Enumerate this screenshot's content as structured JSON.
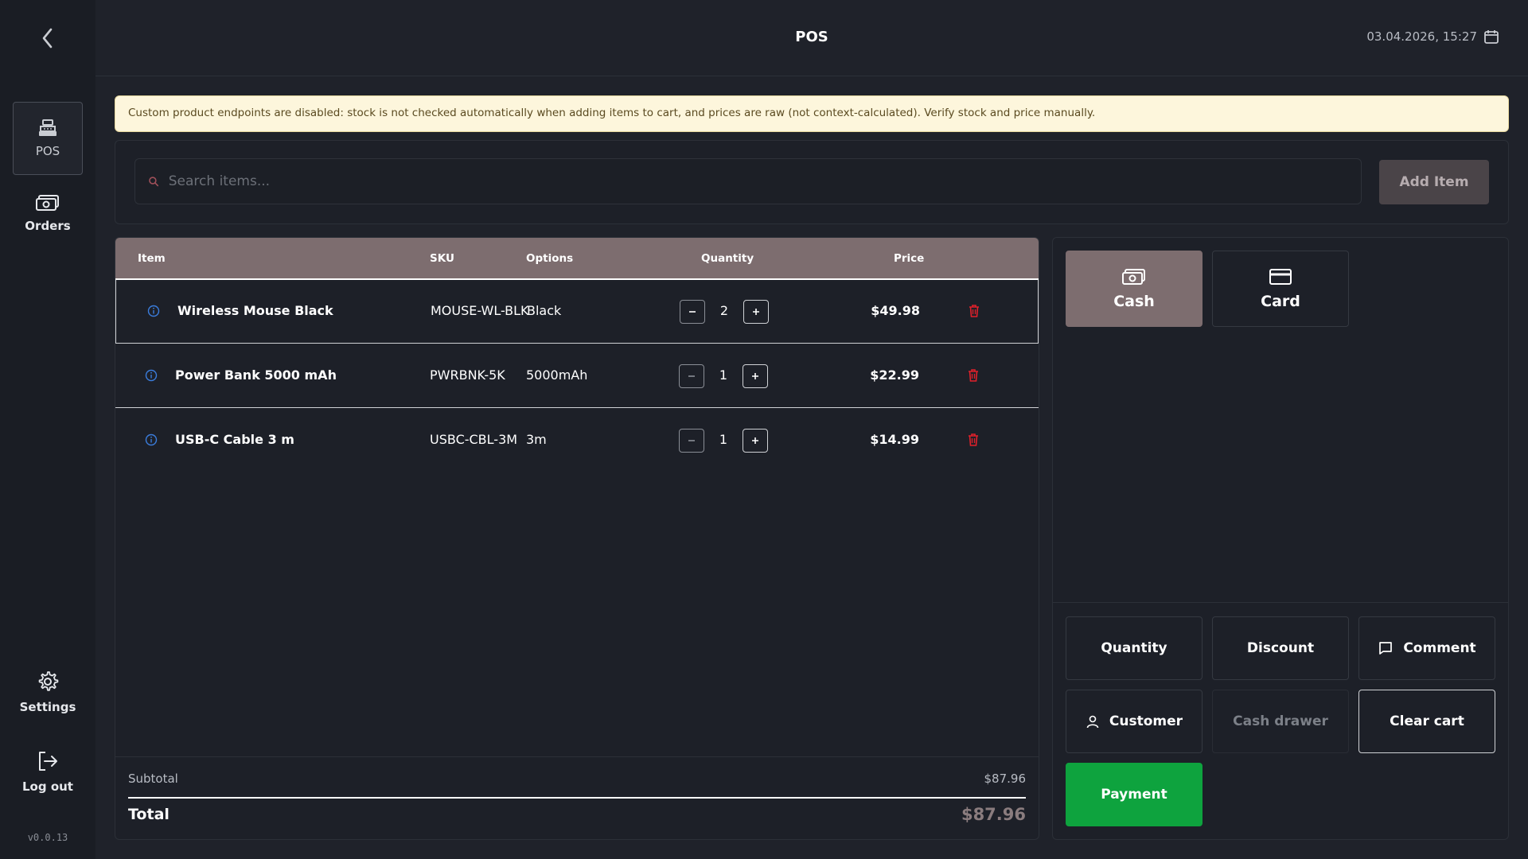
{
  "app": {
    "title": "POS",
    "datetime": "03.04.2026, 15:27",
    "version": "v0.0.13"
  },
  "sidebar": {
    "items": [
      {
        "label": "POS",
        "icon": "cash-register-icon"
      },
      {
        "label": "Orders",
        "icon": "money-bill-icon"
      }
    ],
    "bottom": [
      {
        "label": "Settings",
        "icon": "gear-icon"
      },
      {
        "label": "Log out",
        "icon": "logout-icon"
      }
    ]
  },
  "warning": "Custom product endpoints are disabled: stock is not checked automatically when adding items to cart, and prices are raw (not context-calculated). Verify stock and price manually.",
  "search": {
    "placeholder": "Search items...",
    "add_label": "Add Item"
  },
  "cart": {
    "columns": {
      "item": "Item",
      "sku": "SKU",
      "options": "Options",
      "quantity": "Quantity",
      "price": "Price"
    },
    "rows": [
      {
        "name": "Wireless Mouse Black",
        "sku": "MOUSE-WL-BLK",
        "options": "Black",
        "qty": "2",
        "price": "$49.98"
      },
      {
        "name": "Power Bank 5000 mAh",
        "sku": "PWRBNK-5K",
        "options": "5000mAh",
        "qty": "1",
        "price": "$22.99"
      },
      {
        "name": "USB-C Cable 3 m",
        "sku": "USBC-CBL-3M",
        "options": "3m",
        "qty": "1",
        "price": "$14.99"
      }
    ],
    "subtotal_label": "Subtotal",
    "subtotal": "$87.96",
    "total_label": "Total",
    "total": "$87.96"
  },
  "payment_methods": [
    {
      "label": "Cash",
      "active": true
    },
    {
      "label": "Card",
      "active": false
    }
  ],
  "actions": {
    "quantity": "Quantity",
    "discount": "Discount",
    "comment": "Comment",
    "customer": "Customer",
    "cash_drawer": "Cash drawer",
    "clear_cart": "Clear cart",
    "payment": "Payment"
  },
  "colors": {
    "accent": "#7d6d6f",
    "payment": "#0ea33e",
    "danger": "#e0202a",
    "info": "#3b7ddd"
  }
}
